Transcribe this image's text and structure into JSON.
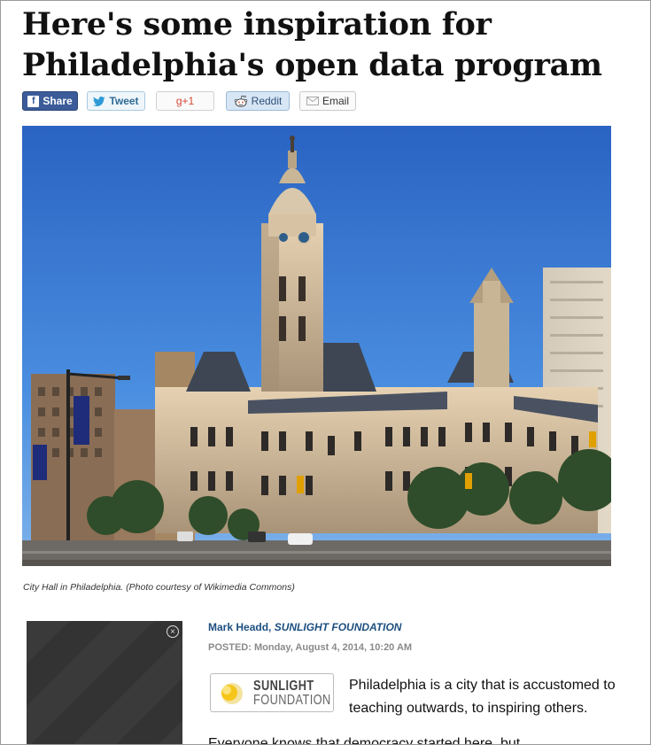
{
  "article": {
    "headline": "Here's some inspiration for Philadelphia's open data program",
    "caption": "City Hall in Philadelphia. (Photo courtesy of Wikimedia Commons)",
    "author": "Mark Headd",
    "organization": "SUNLIGHT FOUNDATION",
    "posted_label": "POSTED:",
    "posted_date": "Monday, August 4, 2014, 10:20 AM",
    "intro": "Philadelphia is a city that is accustomed to teaching outwards, to inspiring others.",
    "partial_next_line": "Everyone knows that democracy started here, but"
  },
  "share_buttons": {
    "facebook": {
      "label": "Share",
      "icon": "f"
    },
    "twitter": {
      "label": "Tweet"
    },
    "googleplus": {
      "label": "g+1"
    },
    "reddit": {
      "label": "Reddit"
    },
    "email": {
      "label": "Email"
    }
  },
  "logo": {
    "line1": "SUNLIGHT",
    "line2": "FOUNDATION"
  },
  "ad": {
    "close_glyph": "×"
  },
  "colors": {
    "facebook": "#3b5b99",
    "twitter": "#2e6a94",
    "googleplus": "#d54634",
    "byline": "#1d4f80",
    "sky": "#2f6fc7"
  }
}
